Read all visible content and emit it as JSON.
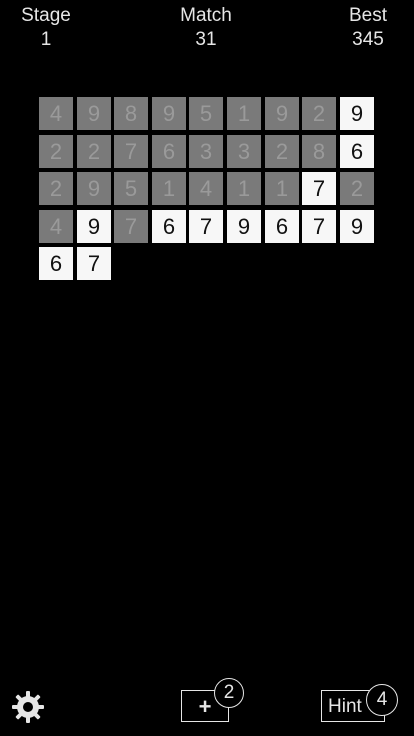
{
  "stats": {
    "stage_label": "Stage",
    "stage_value": "1",
    "match_label": "Match",
    "match_value": "31",
    "best_label": "Best",
    "best_value": "345"
  },
  "board": {
    "columns": 9,
    "cells": [
      {
        "value": "4",
        "used": true
      },
      {
        "value": "9",
        "used": true
      },
      {
        "value": "8",
        "used": true
      },
      {
        "value": "9",
        "used": true
      },
      {
        "value": "5",
        "used": true
      },
      {
        "value": "1",
        "used": true
      },
      {
        "value": "9",
        "used": true
      },
      {
        "value": "2",
        "used": true
      },
      {
        "value": "9",
        "used": false
      },
      {
        "value": "2",
        "used": true
      },
      {
        "value": "2",
        "used": true
      },
      {
        "value": "7",
        "used": true
      },
      {
        "value": "6",
        "used": true
      },
      {
        "value": "3",
        "used": true
      },
      {
        "value": "3",
        "used": true
      },
      {
        "value": "2",
        "used": true
      },
      {
        "value": "8",
        "used": true
      },
      {
        "value": "6",
        "used": false
      },
      {
        "value": "2",
        "used": true
      },
      {
        "value": "9",
        "used": true
      },
      {
        "value": "5",
        "used": true
      },
      {
        "value": "1",
        "used": true
      },
      {
        "value": "4",
        "used": true
      },
      {
        "value": "1",
        "used": true
      },
      {
        "value": "1",
        "used": true
      },
      {
        "value": "7",
        "used": false
      },
      {
        "value": "2",
        "used": true
      },
      {
        "value": "4",
        "used": true
      },
      {
        "value": "9",
        "used": false
      },
      {
        "value": "7",
        "used": true
      },
      {
        "value": "6",
        "used": false
      },
      {
        "value": "7",
        "used": false
      },
      {
        "value": "9",
        "used": false
      },
      {
        "value": "6",
        "used": false
      },
      {
        "value": "7",
        "used": false
      },
      {
        "value": "9",
        "used": false
      },
      {
        "value": "6",
        "used": false
      },
      {
        "value": "7",
        "used": false
      }
    ]
  },
  "controls": {
    "settings_icon": "gear-icon",
    "add_icon": "plus-icon",
    "add_glyph": "+",
    "add_remaining": "2",
    "hint_label": "Hint",
    "hint_remaining": "4"
  },
  "colors": {
    "background": "#000000",
    "active_cell": "#f7f7f7",
    "used_cell": "#7a7a7a",
    "text": "#e6e6e6"
  }
}
